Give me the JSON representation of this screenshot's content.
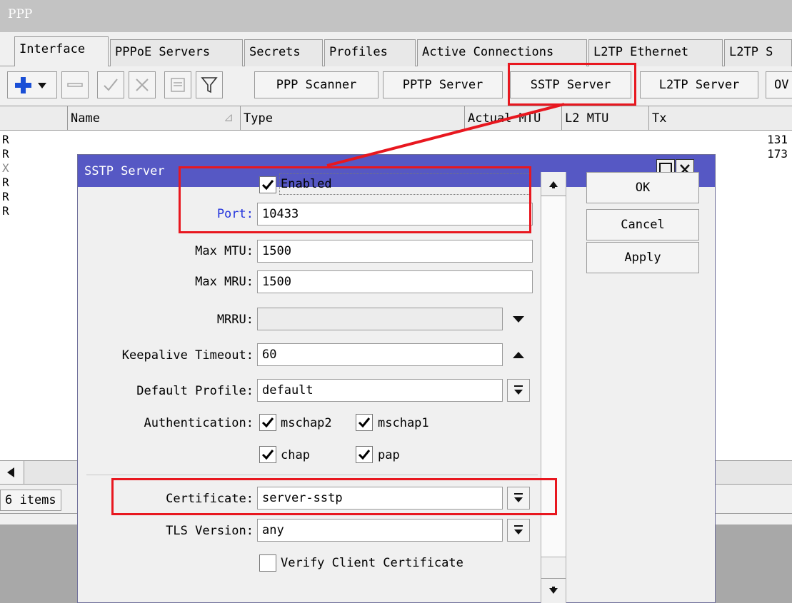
{
  "window": {
    "title": "PPP"
  },
  "tabs": [
    {
      "label": "Interface"
    },
    {
      "label": "PPPoE Servers"
    },
    {
      "label": "Secrets"
    },
    {
      "label": "Profiles"
    },
    {
      "label": "Active Connections"
    },
    {
      "label": "L2TP Ethernet"
    },
    {
      "label": "L2TP S"
    }
  ],
  "toolbar": {
    "icons": [
      "add-icon",
      "remove-icon",
      "enable-icon",
      "disable-icon",
      "comment-icon",
      "filter-icon"
    ],
    "buttons": [
      {
        "label": "PPP Scanner"
      },
      {
        "label": "PPTP Server"
      },
      {
        "label": "SSTP Server"
      },
      {
        "label": "L2TP Server"
      },
      {
        "label": "OV"
      }
    ]
  },
  "table": {
    "columns": [
      "Name",
      "Type",
      "Actual MTU",
      "L2 MTU",
      "Tx"
    ],
    "rows": [
      {
        "flag": "R",
        "tx": "131"
      },
      {
        "flag": "R",
        "tx": "173"
      },
      {
        "flag": "X",
        "tx": ""
      },
      {
        "flag": "R",
        "tx": ""
      },
      {
        "flag": "R",
        "tx": ""
      },
      {
        "flag": "R",
        "tx": ""
      }
    ]
  },
  "status": {
    "count": "6 items"
  },
  "dialog": {
    "title": "SSTP Server",
    "enabled": {
      "label": "Enabled",
      "checked": true
    },
    "port": {
      "label": "Port:",
      "value": "10433"
    },
    "max_mtu": {
      "label": "Max MTU:",
      "value": "1500"
    },
    "max_mru": {
      "label": "Max MRU:",
      "value": "1500"
    },
    "mrru": {
      "label": "MRRU:",
      "value": ""
    },
    "keepalive": {
      "label": "Keepalive Timeout:",
      "value": "60"
    },
    "default_profile": {
      "label": "Default Profile:",
      "value": "default"
    },
    "authentication": {
      "label": "Authentication:",
      "options": [
        {
          "label": "mschap2",
          "checked": true
        },
        {
          "label": "mschap1",
          "checked": true
        },
        {
          "label": "chap",
          "checked": true
        },
        {
          "label": "pap",
          "checked": true
        }
      ]
    },
    "certificate": {
      "label": "Certificate:",
      "value": "server-sstp"
    },
    "tls_version": {
      "label": "TLS Version:",
      "value": "any"
    },
    "verify_client": {
      "label": "Verify Client Certificate",
      "checked": false
    },
    "buttons": {
      "ok": "OK",
      "cancel": "Cancel",
      "apply": "Apply"
    }
  },
  "colors": {
    "dialog_title_bar": "#5658c4",
    "highlight": "#e8171f",
    "port_label": "#2233dd",
    "add_icon": "#1a4fd6"
  }
}
